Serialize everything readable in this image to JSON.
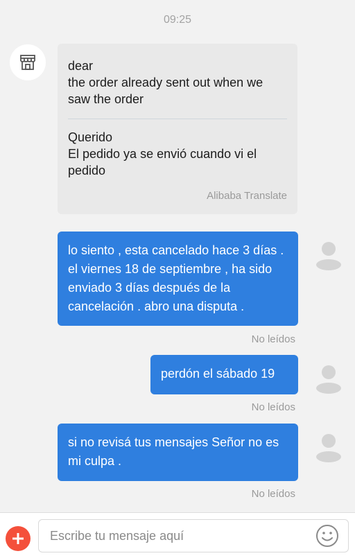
{
  "time": "09:25",
  "incoming": {
    "original_lines": [
      "dear",
      "the order already sent out when we saw the order"
    ],
    "translation_lines": [
      "Querido",
      "El pedido ya se envió cuando vi el pedido"
    ],
    "translate_label": "Alibaba Translate"
  },
  "outgoing": [
    {
      "text": "lo siento , esta cancelado hace 3 días . el viernes 18 de septiembre , ha sido enviado 3 días después de la cancelación . abro una disputa .",
      "status": "No leídos"
    },
    {
      "text": "perdón el sábado 19",
      "status": "No leídos"
    },
    {
      "text": "si no revisá tus mensajes Señor no es mi culpa .",
      "status": "No leídos"
    }
  ],
  "composer": {
    "placeholder": "Escribe tu mensaje aquí",
    "add_icon": "plus-icon",
    "emoji_icon": "smiley-icon"
  },
  "colors": {
    "outgoing_bubble": "#2f7fdf",
    "add_button": "#f4503b"
  }
}
